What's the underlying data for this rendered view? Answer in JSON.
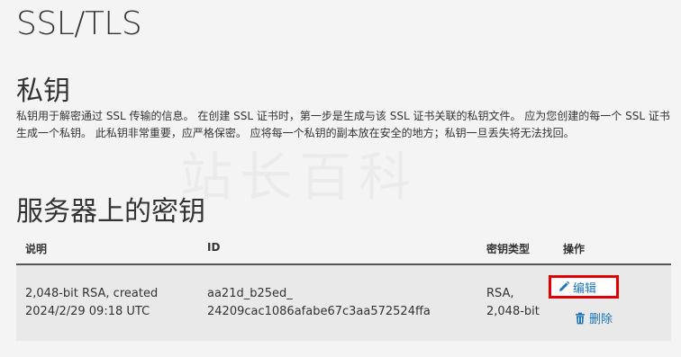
{
  "page": {
    "title": "SSL/TLS"
  },
  "private_keys": {
    "heading": "私钥",
    "description": "私钥用于解密通过 SSL 传输的信息。 在创建 SSL 证书时，第一步是生成与该 SSL 证书关联的私钥文件。 应为您创建的每一个 SSL 证书生成一个私钥。 此私钥非常重要，应严格保密。 应将每一个私钥的副本放在安全的地方；私钥一旦丢失将无法找回。"
  },
  "keys_on_server": {
    "heading": "服务器上的密钥",
    "columns": {
      "description": "说明",
      "id": "ID",
      "key_type": "密钥类型",
      "actions": "操作"
    },
    "rows": [
      {
        "description_line1": "2,048-bit RSA, created",
        "description_line2": "2024/2/29 09:18 UTC",
        "id_line1": "aa21d_b25ed_",
        "id_line2": "24209cac1086afabe67c3aa572524ffa",
        "key_type_line1": "RSA,",
        "key_type_line2": "2,048-bit",
        "edit_label": "编辑",
        "delete_label": "删除"
      }
    ]
  },
  "watermark": "站长百科",
  "colors": {
    "link": "#1b75bb",
    "highlight_border": "#e00000",
    "row_bg": "#e9e9e9"
  },
  "icons": {
    "edit": "pencil-icon",
    "delete": "trash-icon"
  }
}
